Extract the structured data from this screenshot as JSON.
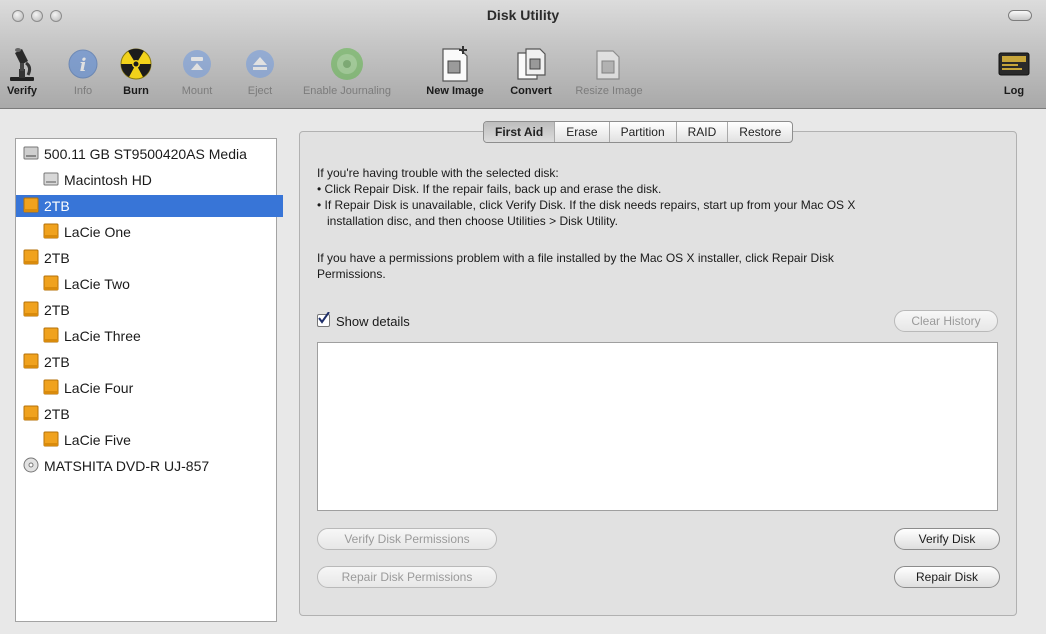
{
  "window": {
    "title": "Disk Utility"
  },
  "toolbar": {
    "verify": "Verify",
    "info": "Info",
    "burn": "Burn",
    "mount": "Mount",
    "eject": "Eject",
    "enable_journaling": "Enable Journaling",
    "new_image": "New Image",
    "convert": "Convert",
    "resize_image": "Resize Image",
    "log": "Log"
  },
  "sidebar": {
    "items": [
      {
        "label": "500.11 GB ST9500420AS Media",
        "kind": "internal-disk",
        "level": 0
      },
      {
        "label": "Macintosh HD",
        "kind": "internal-volume",
        "level": 1
      },
      {
        "label": "2TB",
        "kind": "external-disk",
        "level": 0,
        "selected": true
      },
      {
        "label": "LaCie One",
        "kind": "external-volume",
        "level": 1
      },
      {
        "label": "2TB",
        "kind": "external-disk",
        "level": 0
      },
      {
        "label": "LaCie Two",
        "kind": "external-volume",
        "level": 1
      },
      {
        "label": "2TB",
        "kind": "external-disk",
        "level": 0
      },
      {
        "label": "LaCie Three",
        "kind": "external-volume",
        "level": 1
      },
      {
        "label": "2TB",
        "kind": "external-disk",
        "level": 0
      },
      {
        "label": "LaCie Four",
        "kind": "external-volume",
        "level": 1
      },
      {
        "label": "2TB",
        "kind": "external-disk",
        "level": 0
      },
      {
        "label": "LaCie Five",
        "kind": "external-volume",
        "level": 1
      },
      {
        "label": "MATSHITA DVD-R UJ-857",
        "kind": "optical-drive",
        "level": 0
      }
    ]
  },
  "tabs": [
    "First Aid",
    "Erase",
    "Partition",
    "RAID",
    "Restore"
  ],
  "active_tab": "First Aid",
  "first_aid": {
    "intro": "If you're having trouble with the selected disk:",
    "bullet1": "• Click Repair Disk. If the repair fails, back up and erase the disk.",
    "bullet2": "• If Repair Disk is unavailable, click Verify Disk. If the disk needs repairs, start up from your Mac OS X",
    "bullet2_cont": "installation disc, and then choose Utilities > Disk Utility.",
    "perm1": "If you have a permissions problem with a file installed by the Mac OS X installer, click Repair Disk",
    "perm2": "Permissions.",
    "show_details": "Show details",
    "show_details_checked": true,
    "clear_history": "Clear History",
    "verify_permissions": "Verify Disk Permissions",
    "repair_permissions": "Repair Disk Permissions",
    "verify_disk": "Verify Disk",
    "repair_disk": "Repair Disk"
  },
  "colors": {
    "selection": "#3875d7",
    "external_disk": "#f0a21e",
    "journaling_icon": "#5db548"
  }
}
